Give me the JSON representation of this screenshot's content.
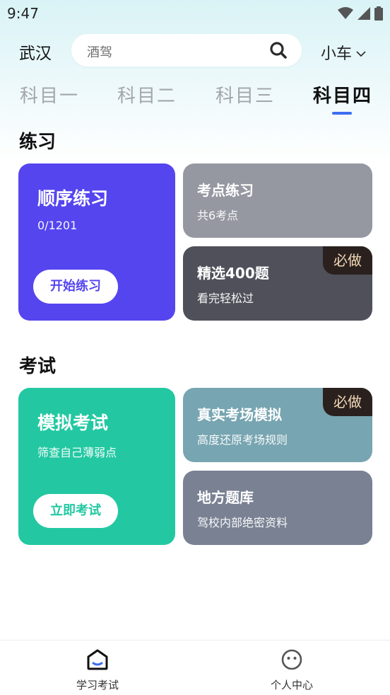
{
  "status_bar": {
    "time": "9:47"
  },
  "header": {
    "city": "武汉",
    "search_placeholder": "酒驾",
    "vehicle_type": "小车"
  },
  "tabs": [
    {
      "label": "科目一",
      "active": false
    },
    {
      "label": "科目二",
      "active": false
    },
    {
      "label": "科目三",
      "active": false
    },
    {
      "label": "科目四",
      "active": true
    }
  ],
  "practice": {
    "section_title": "练习",
    "sequential": {
      "title": "顺序练习",
      "progress": "0/1201",
      "button": "开始练习"
    },
    "key_points": {
      "title": "考点练习",
      "subtitle": "共6考点"
    },
    "selected": {
      "title": "精选400题",
      "subtitle": "看完轻松过",
      "badge": "必做"
    }
  },
  "exam": {
    "section_title": "考试",
    "mock": {
      "title": "模拟考试",
      "subtitle": "筛查自己薄弱点",
      "button": "立即考试"
    },
    "real_sim": {
      "title": "真实考场模拟",
      "subtitle": "高度还原考场规则",
      "badge": "必做"
    },
    "local_bank": {
      "title": "地方题库",
      "subtitle": "驾校内部绝密资料"
    }
  },
  "bottom_nav": [
    {
      "label": "学习考试",
      "icon": "home-icon"
    },
    {
      "label": "个人中心",
      "icon": "face-icon"
    }
  ],
  "colors": {
    "sequential_card": "#5545ef",
    "key_points_card": "#9598a1",
    "selected_card": "#4f5059",
    "mock_card": "#23c8a2",
    "real_sim_card": "#77a5b1",
    "local_bank_card": "#798193",
    "tab_indicator": "#3d6df2",
    "badge_bg": "#2a211f",
    "badge_text": "#f3d9b6"
  }
}
